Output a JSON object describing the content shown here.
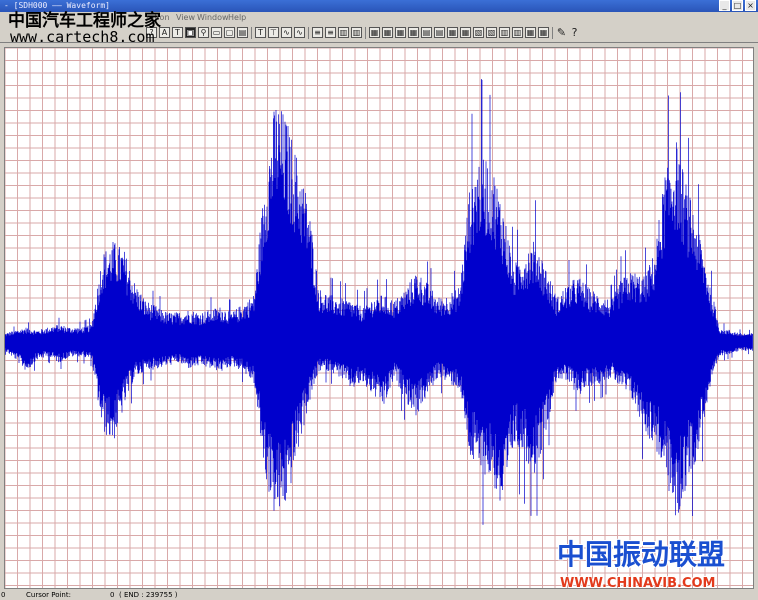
{
  "window": {
    "title": "- [SDH000 —— Waveform]",
    "minimize_glyph": "_",
    "maximize_glyph": "□",
    "close_glyph": "×"
  },
  "menu": {
    "items": [
      "ration",
      "View",
      "Window",
      "Help"
    ]
  },
  "toolbar": {
    "icons": [
      "?",
      "A",
      "T",
      "▣",
      "⚲",
      "▭",
      "▢",
      "▤",
      "T",
      "⊤",
      "∿",
      "∿",
      "≡",
      "≡",
      "▥",
      "▥",
      "▦",
      "▦",
      "▦",
      "▦",
      "▤",
      "▤",
      "▦",
      "▦",
      "▧",
      "▧",
      "▥",
      "▥",
      "▦",
      "▦",
      "✎",
      "?"
    ]
  },
  "watermarks": {
    "top_cn": "中国汽车工程师之家",
    "top_url": "www.cartech8.com",
    "bottom_cn": "中国振动联盟",
    "bottom_url": "WWW.CHINAVIB.COM"
  },
  "status": {
    "left_value": "0",
    "cursor_label": "Cursor Point:",
    "cursor_value": "0",
    "end_text": "( END : 239755 )"
  },
  "colors": {
    "waveform": "#0000cc",
    "grid": "#d9a9a9",
    "background": "#ffffff"
  },
  "chart_data": {
    "type": "line",
    "title": "",
    "xlabel": "",
    "ylabel": "",
    "x_range": [
      0,
      239755
    ],
    "ylim": [
      -1,
      1
    ],
    "grid": true,
    "series": [
      {
        "envelope_upper": [
          0.03,
          0.04,
          0.05,
          0.04,
          0.05,
          0.06,
          0.05,
          0.05,
          0.06,
          0.3,
          0.34,
          0.31,
          0.2,
          0.14,
          0.12,
          0.1,
          0.1,
          0.11,
          0.1,
          0.11,
          0.12,
          0.1,
          0.13,
          0.16,
          0.55,
          0.82,
          0.75,
          0.62,
          0.48,
          0.18,
          0.16,
          0.15,
          0.14,
          0.12,
          0.15,
          0.16,
          0.14,
          0.18,
          0.24,
          0.2,
          0.15,
          0.16,
          0.19,
          0.55,
          0.65,
          0.6,
          0.46,
          0.26,
          0.31,
          0.35,
          0.25,
          0.15,
          0.2,
          0.22,
          0.18,
          0.16,
          0.14,
          0.22,
          0.24,
          0.22,
          0.3,
          0.58,
          0.68,
          0.52,
          0.4,
          0.22,
          0.05,
          0.04,
          0.03,
          0.03
        ],
        "envelope_lower": [
          -0.03,
          -0.06,
          -0.1,
          -0.06,
          -0.05,
          -0.07,
          -0.05,
          -0.05,
          -0.06,
          -0.3,
          -0.34,
          -0.22,
          -0.12,
          -0.1,
          -0.09,
          -0.08,
          -0.07,
          -0.09,
          -0.08,
          -0.09,
          -0.1,
          -0.08,
          -0.1,
          -0.14,
          -0.45,
          -0.6,
          -0.55,
          -0.38,
          -0.22,
          -0.1,
          -0.1,
          -0.12,
          -0.16,
          -0.14,
          -0.18,
          -0.22,
          -0.12,
          -0.2,
          -0.25,
          -0.18,
          -0.12,
          -0.14,
          -0.16,
          -0.4,
          -0.45,
          -0.46,
          -0.6,
          -0.35,
          -0.4,
          -0.45,
          -0.3,
          -0.12,
          -0.14,
          -0.18,
          -0.15,
          -0.14,
          -0.12,
          -0.16,
          -0.2,
          -0.3,
          -0.35,
          -0.45,
          -0.62,
          -0.48,
          -0.38,
          -0.18,
          -0.05,
          -0.04,
          -0.03,
          -0.03
        ]
      }
    ]
  }
}
